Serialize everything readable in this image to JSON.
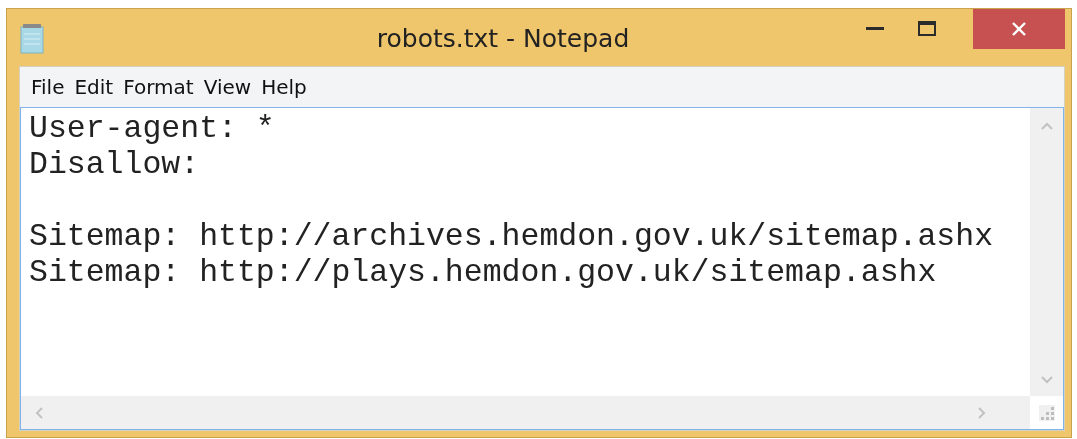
{
  "window": {
    "title": "robots.txt - Notepad"
  },
  "menu": [
    "File",
    "Edit",
    "Format",
    "View",
    "Help"
  ],
  "document": {
    "blocks": [
      [
        "User-agent: *",
        "Disallow:"
      ],
      [
        "Sitemap: http://archives.hemdon.gov.uk/sitemap.ashx",
        "Sitemap: http://plays.hemdon.gov.uk/sitemap.ashx"
      ]
    ]
  }
}
